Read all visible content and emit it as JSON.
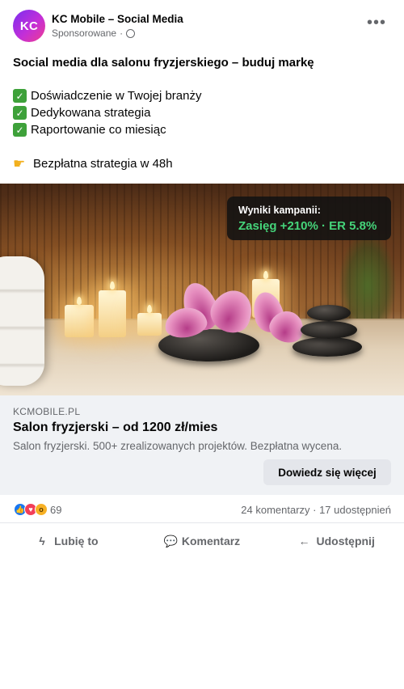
{
  "header": {
    "avatar_initials": "KC",
    "page_name": "KC Mobile – Social Media",
    "meta_label": "Sponsorowane",
    "separator": "·"
  },
  "post": {
    "headline": "Social media dla salonu fryzjerskiego – buduj markę",
    "bullets": [
      "Doświadczenie w Twojej branży",
      "Dedykowana strategia",
      "Raportowanie co miesiąc"
    ],
    "offer": "Bezpłatna strategia w 48h"
  },
  "media": {
    "result_title": "Wyniki kampanii:",
    "result_value": "Zasięg +210% · ER 5.8%"
  },
  "link": {
    "domain": "KCMOBILE.PL",
    "title": "Salon fryzjerski – od 1200 zł/mies",
    "description": "Salon fryzjerski. 500+ zrealizowanych projektów. Bezpłatna wycena.",
    "cta": "Dowiedz się więcej"
  },
  "engagement": {
    "reactions_count": "69",
    "comments_shares": "24 komentarzy · 17 udostępnień"
  },
  "actions": {
    "like": "Lubię to",
    "comment": "Komentarz",
    "share": "Udostępnij"
  },
  "icons": [
    "globe-icon",
    "more-icon",
    "check-icon",
    "point-right-icon",
    "like-reaction-icon",
    "love-reaction-icon",
    "wow-reaction-icon",
    "like-icon",
    "comment-icon",
    "share-icon"
  ],
  "colors": {
    "accent_green": "#45d47a",
    "link_background": "#f0f2f5",
    "secondary_text": "#65676b"
  }
}
